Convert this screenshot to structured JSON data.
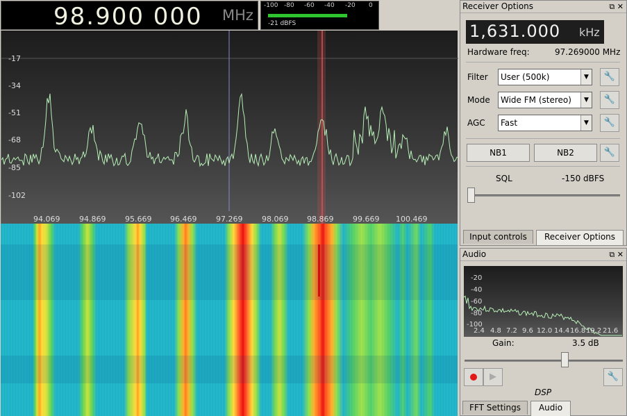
{
  "frequency": {
    "digits": "98.900 000",
    "unit": "MHz"
  },
  "signal_meter": {
    "ticks": [
      "-100",
      "-80",
      "-60",
      "-40",
      "-20",
      "0"
    ],
    "level_label": "-21 dBFS",
    "level_db": -21,
    "bar_color": "#2ec52e"
  },
  "spectrum": {
    "y_ticks": [
      "-17",
      "-34",
      "-51",
      "-68",
      "-85",
      "-102"
    ],
    "x_ticks": [
      "94.069",
      "94.869",
      "95.669",
      "96.469",
      "97.269",
      "98.069",
      "98.869",
      "99.669",
      "100.469"
    ],
    "trace_color": "#b8f0b8",
    "cursor_color": "#e05050",
    "center_line_color": "#8888cc"
  },
  "receiver_options": {
    "title": "Receiver Options",
    "offset_digits": "1,631.000",
    "offset_unit": "kHz",
    "hardware_freq_label": "Hardware freq:",
    "hardware_freq_value": "97.269000 MHz",
    "filter_label": "Filter",
    "filter_value": "User (500k)",
    "mode_label": "Mode",
    "mode_value": "Wide FM (stereo)",
    "agc_label": "AGC",
    "agc_value": "Fast",
    "nb1_label": "NB1",
    "nb2_label": "NB2",
    "sql_label": "SQL",
    "sql_value": "-150 dBFS",
    "tabs": [
      "Input controls",
      "Receiver Options"
    ],
    "active_tab": "Receiver Options"
  },
  "audio": {
    "title": "Audio",
    "y_ticks": [
      "-20",
      "-40",
      "-60",
      "-80",
      "-100"
    ],
    "x_ticks": [
      "2.4",
      "4.8",
      "7.2",
      "9.6",
      "12.0",
      "14.4",
      "16.8",
      "19.2",
      "21.6"
    ],
    "gain_label": "Gain:",
    "gain_value": "3.5 dB",
    "dsp_label": "DSP",
    "tabs": [
      "FFT Settings",
      "Audio"
    ],
    "active_tab": "Audio"
  },
  "icons": {
    "float_icon": "⧉",
    "close_icon": "✕",
    "dropdown_icon": "▼",
    "options_icon": "🔧",
    "play_icon": "▶"
  }
}
